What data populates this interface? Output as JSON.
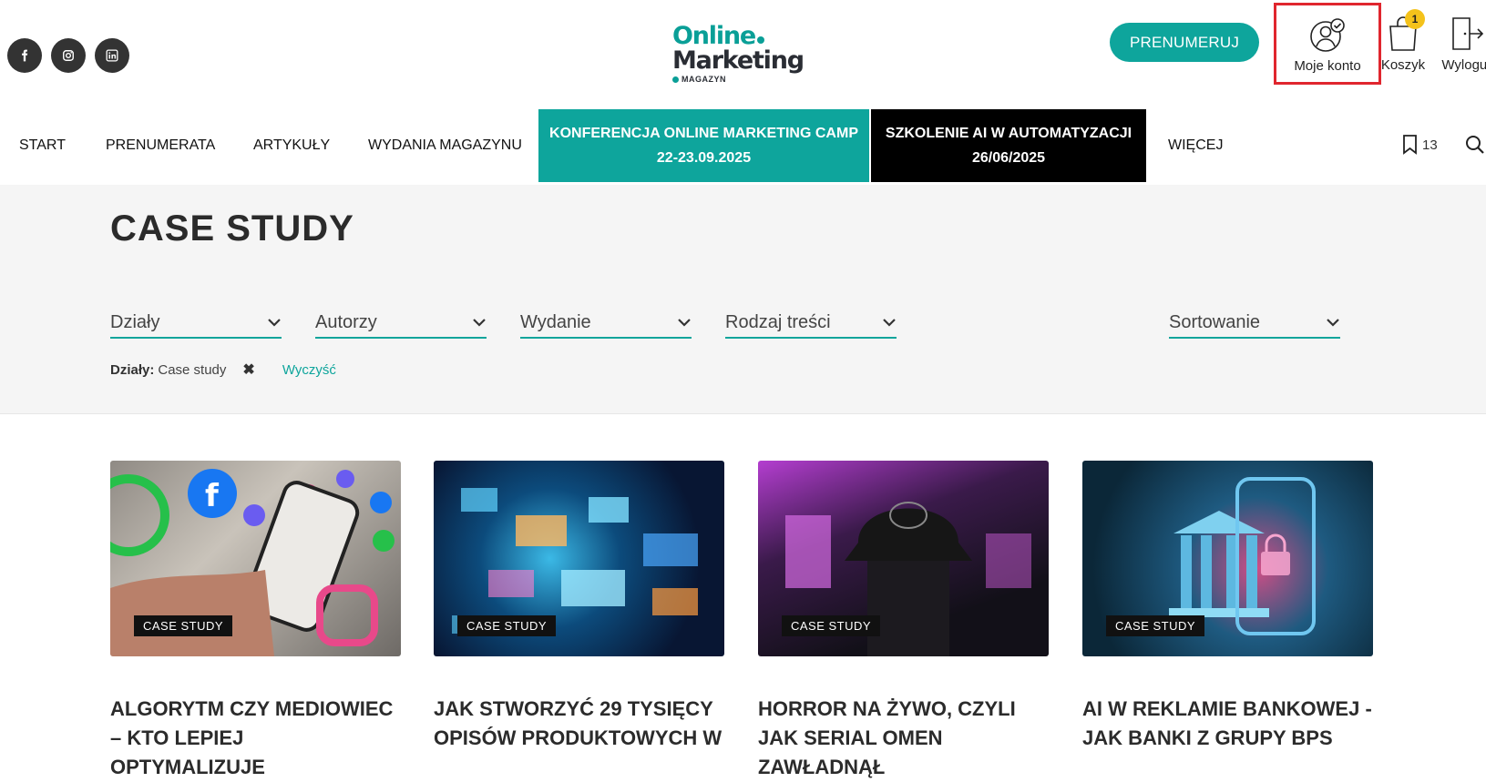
{
  "header": {
    "logo": {
      "line1": "Online",
      "line2": "Marketing",
      "line3": "MAGAZYN"
    },
    "subscribe_label": "PRENUMERUJ",
    "account_label": "Moje konto",
    "cart_label": "Koszyk",
    "cart_count": "1",
    "logout_label": "Wyloguj",
    "social": [
      "facebook-icon",
      "instagram-icon",
      "linkedin-icon"
    ]
  },
  "nav": {
    "items": [
      "START",
      "PRENUMERATA",
      "ARTYKUŁY",
      "WYDANIA MAGAZYNU"
    ],
    "promo1": {
      "line1": "KONFERENCJA ONLINE MARKETING CAMP",
      "line2": "22-23.09.2025"
    },
    "promo2": {
      "line1": "SZKOLENIE AI W AUTOMATYZACJI",
      "line2": "26/06/2025"
    },
    "more": "WIĘCEJ",
    "bookmarks_count": "13"
  },
  "page": {
    "title": "CASE STUDY",
    "filters": [
      "Działy",
      "Autorzy",
      "Wydanie",
      "Rodzaj treści"
    ],
    "sort_label": "Sortowanie",
    "active_filter": {
      "label": "Działy:",
      "value": "Case study"
    },
    "clear_label": "Wyczyść"
  },
  "cards": [
    {
      "tag": "CASE STUDY",
      "title": "ALGORYTM CZY MEDIOWIEC – KTO LEPIEJ OPTYMALIZUJE"
    },
    {
      "tag": "CASE STUDY",
      "title": "JAK STWORZYĆ 29 TYSIĘCY OPISÓW PRODUKTOWYCH W"
    },
    {
      "tag": "CASE STUDY",
      "title": "HORROR NA ŻYWO, CZYLI JAK SERIAL OMEN ZAWŁADNĄŁ"
    },
    {
      "tag": "CASE STUDY",
      "title": "AI W REKLAMIE BANKOWEJ - JAK BANKI Z GRUPY BPS"
    }
  ],
  "colors": {
    "accent": "#0ea59c",
    "highlight": "#e0262e",
    "badge": "#f4c21b"
  }
}
